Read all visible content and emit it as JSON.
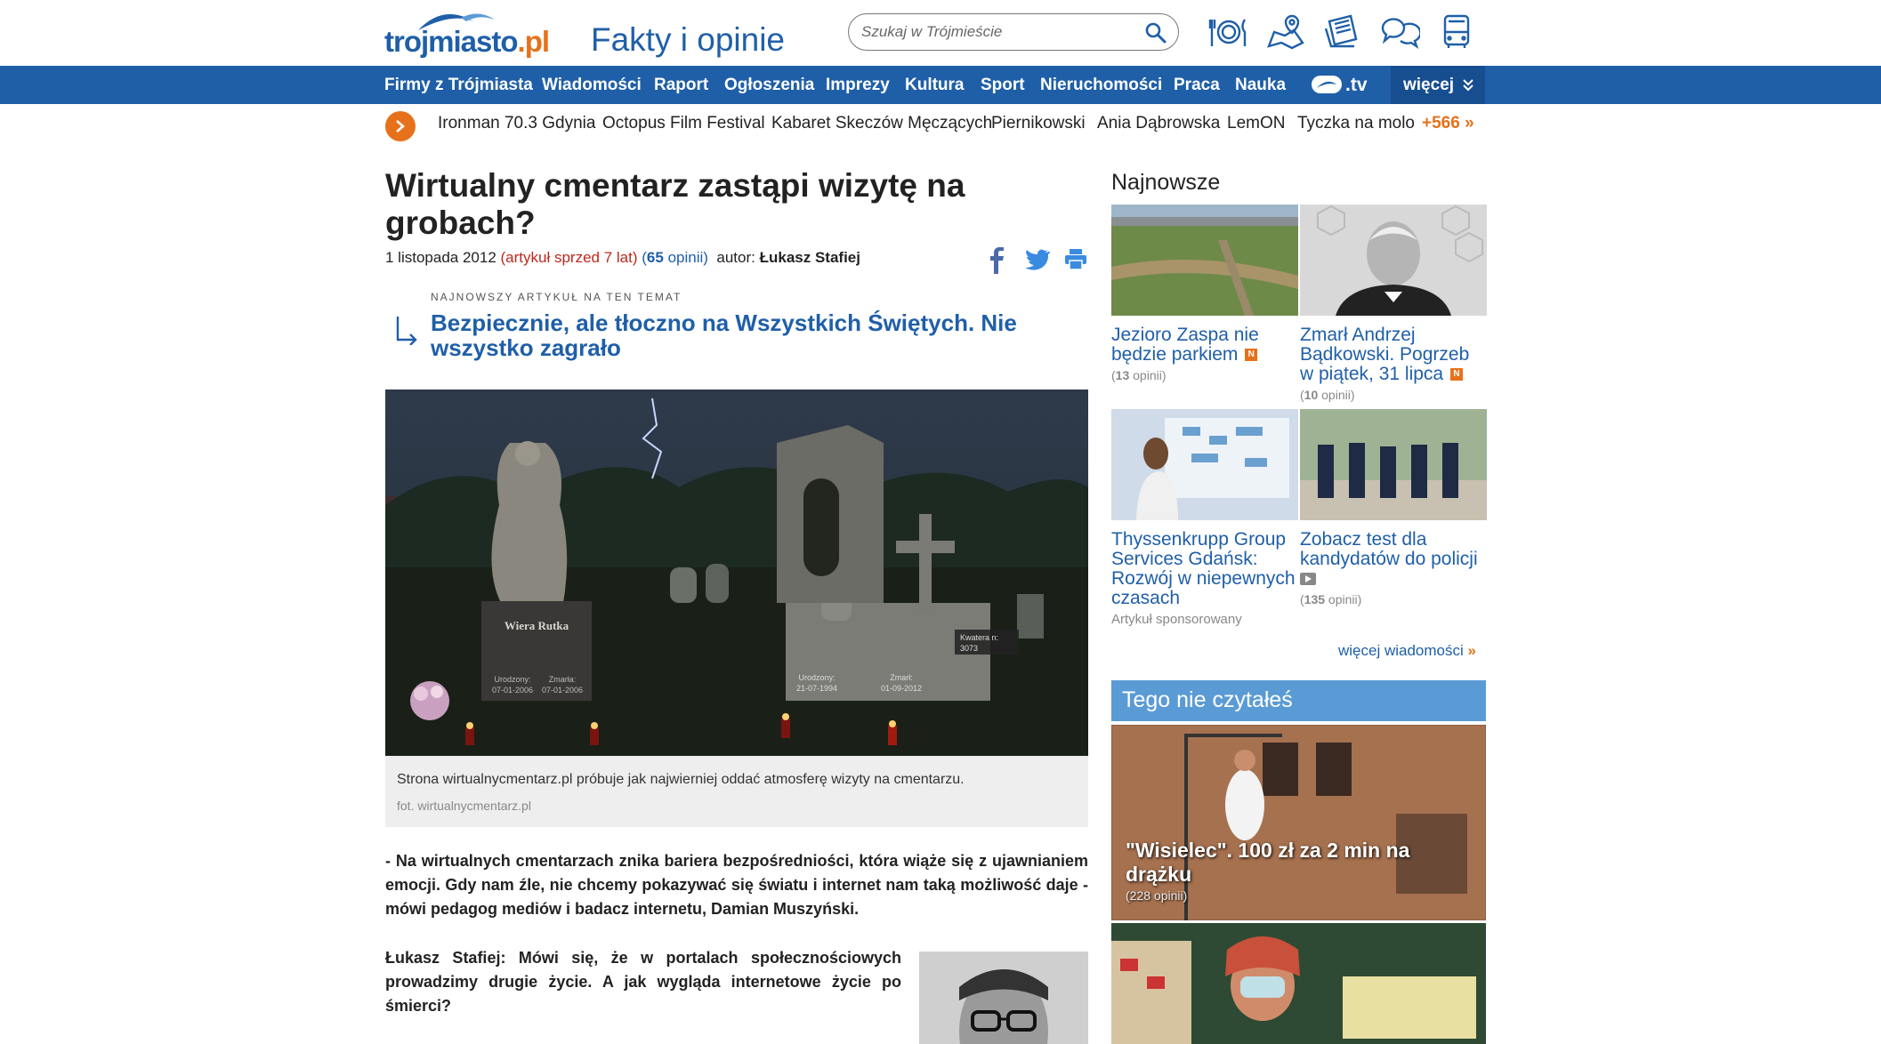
{
  "header": {
    "logo_main": "trojmiasto",
    "logo_tld": ".pl",
    "section": "Fakty i opinie",
    "search_placeholder": "Szukaj w Trójmieście",
    "icons": [
      "food-icon",
      "map-icon",
      "newspaper-icon",
      "chat-icon",
      "bus-icon"
    ]
  },
  "nav": {
    "items": [
      "Firmy z Trójmiasta",
      "Wiadomości",
      "Raport",
      "Ogłoszenia",
      "Imprezy",
      "Kultura",
      "Sport",
      "Nieruchomości",
      "Praca",
      "Nauka"
    ],
    "tv": ".tv",
    "more": "więcej"
  },
  "trending": {
    "items": [
      "Ironman 70.3 Gdynia",
      "Octopus Film Festival",
      "Kabaret Skeczów Męczących",
      "Piernikowski",
      "Ania Dąbrowska",
      "LemON",
      "Tyczka na molo"
    ],
    "more": "+566 »"
  },
  "article": {
    "title": "Wirtualny cmentarz zastąpi wizytę na grobach?",
    "date": "1 listopada 2012",
    "age": "(artykuł sprzed 7 lat)",
    "opinions_open": "(",
    "opinions_count": "65",
    "opinions_label": "opinii)",
    "author_label": "autor:",
    "author": "Łukasz Stafiej",
    "related_label": "NAJNOWSZY ARTYKUŁ NA TEN TEMAT",
    "related_title": "Bezpiecznie, ale tłoczno na Wszystkich Świętych. Nie wszystko zagrało",
    "photo": {
      "grave1_name": "Wiera Rutka",
      "grave1_born_label": "Urodzony:",
      "grave1_born": "07-01-2006",
      "grave1_died_label": "Zmarła:",
      "grave1_died": "07-01-2006",
      "grave2_born_label": "Urodzony:",
      "grave2_born": "21-07-1994",
      "grave2_died_label": "Zmarł:",
      "grave2_died": "01-09-2012",
      "plot_label": "Kwatera n:",
      "plot_number": "3073"
    },
    "caption": "Strona wirtualnycmentarz.pl próbuje jak najwierniej oddać atmosferę wizyty na cmentarzu.",
    "credit": "fot. wirtualnycmentarz.pl",
    "lead": "- Na wirtualnych cmentarzach znika bariera bezpośredniości, która wiąże się z ujawnianiem emocji. Gdy nam źle, nie chcemy pokazywać się światu i internet nam taką możliwość daje - mówi pedagog mediów i badacz internetu, Damian Muszyński.",
    "question": "Łukasz Stafiej: Mówi się, że w portalach społecznościowych prowadzimy drugie życie. A jak wygląda internetowe życie po śmierci?"
  },
  "sidebar": {
    "heading": "Najnowsze",
    "cards": [
      {
        "title": "Jezioro Zaspa nie będzie parkiem",
        "badge": "N",
        "opinions": "13",
        "opinions_label": "opinii"
      },
      {
        "title": "Zmarł Andrzej Bądkowski. Pogrzeb w piątek, 31 lipca",
        "badge": "N",
        "opinions": "10",
        "opinions_label": "opinii"
      },
      {
        "title": "Thyssenkrupp Group Services Gdańsk: Rozwój w niepewnych czasach",
        "sponsored": "Artykuł sponsorowany"
      },
      {
        "title": "Zobacz test dla kandydatów do policji",
        "opinions": "135",
        "opinions_label": "opinii"
      }
    ],
    "more_news": "więcej wiadomości",
    "more_news_arrow": "»",
    "unread_heading": "Tego nie czytałeś",
    "unread": [
      {
        "title": "\"Wisielec\". 100 zł za 2 min na drążku",
        "opinions": "228",
        "opinions_label": "opinii"
      }
    ]
  },
  "colors": {
    "brand_blue": "#1f5fa8",
    "accent_orange": "#e7711b",
    "heading_light_blue": "#5b9bd5",
    "age_red": "#c0271b"
  }
}
